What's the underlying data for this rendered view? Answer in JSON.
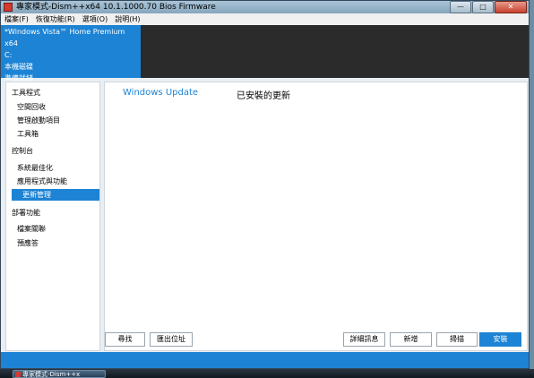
{
  "window": {
    "title": "專家模式-Dism++x64 10.1.1000.70 Bios Firmware",
    "minimize_glyph": "—",
    "maximize_glyph": "□",
    "close_glyph": "✕"
  },
  "menu": [
    {
      "label": "檔案(F)"
    },
    {
      "label": "恢復功能(R)"
    },
    {
      "label": "選項(O)"
    },
    {
      "label": "說明(H)"
    }
  ],
  "info": {
    "os": "*Windows Vista™ Home Premium x64",
    "drive": "C:",
    "disk": "本機磁碟",
    "status": "準備就緒"
  },
  "sidebar": {
    "groups": [
      {
        "label": "工具程式",
        "items": [
          {
            "label": "空間回收"
          },
          {
            "label": "管理啟動項目"
          },
          {
            "label": "工具箱"
          }
        ]
      },
      {
        "label": "控制台",
        "items": [
          {
            "label": "系統最佳化"
          },
          {
            "label": "應用程式與功能"
          },
          {
            "label": "更新管理",
            "active": true
          }
        ]
      },
      {
        "label": "部署功能",
        "items": [
          {
            "label": "檔案關聯"
          },
          {
            "label": "預應答"
          }
        ]
      }
    ]
  },
  "main": {
    "tab_windows_update": "Windows Update",
    "tab_installed": "已安裝的更新",
    "buttons": {
      "scan": "尋找",
      "export": "匯出位址",
      "details": "詳細訊息",
      "add": "新增",
      "scan2": "掃描",
      "install": "安裝"
    }
  },
  "taskbar": {
    "task_label": "專家模式-Dism++x"
  },
  "colors": {
    "accent": "#1d83d4",
    "dark_panel": "#2b2b2b"
  }
}
